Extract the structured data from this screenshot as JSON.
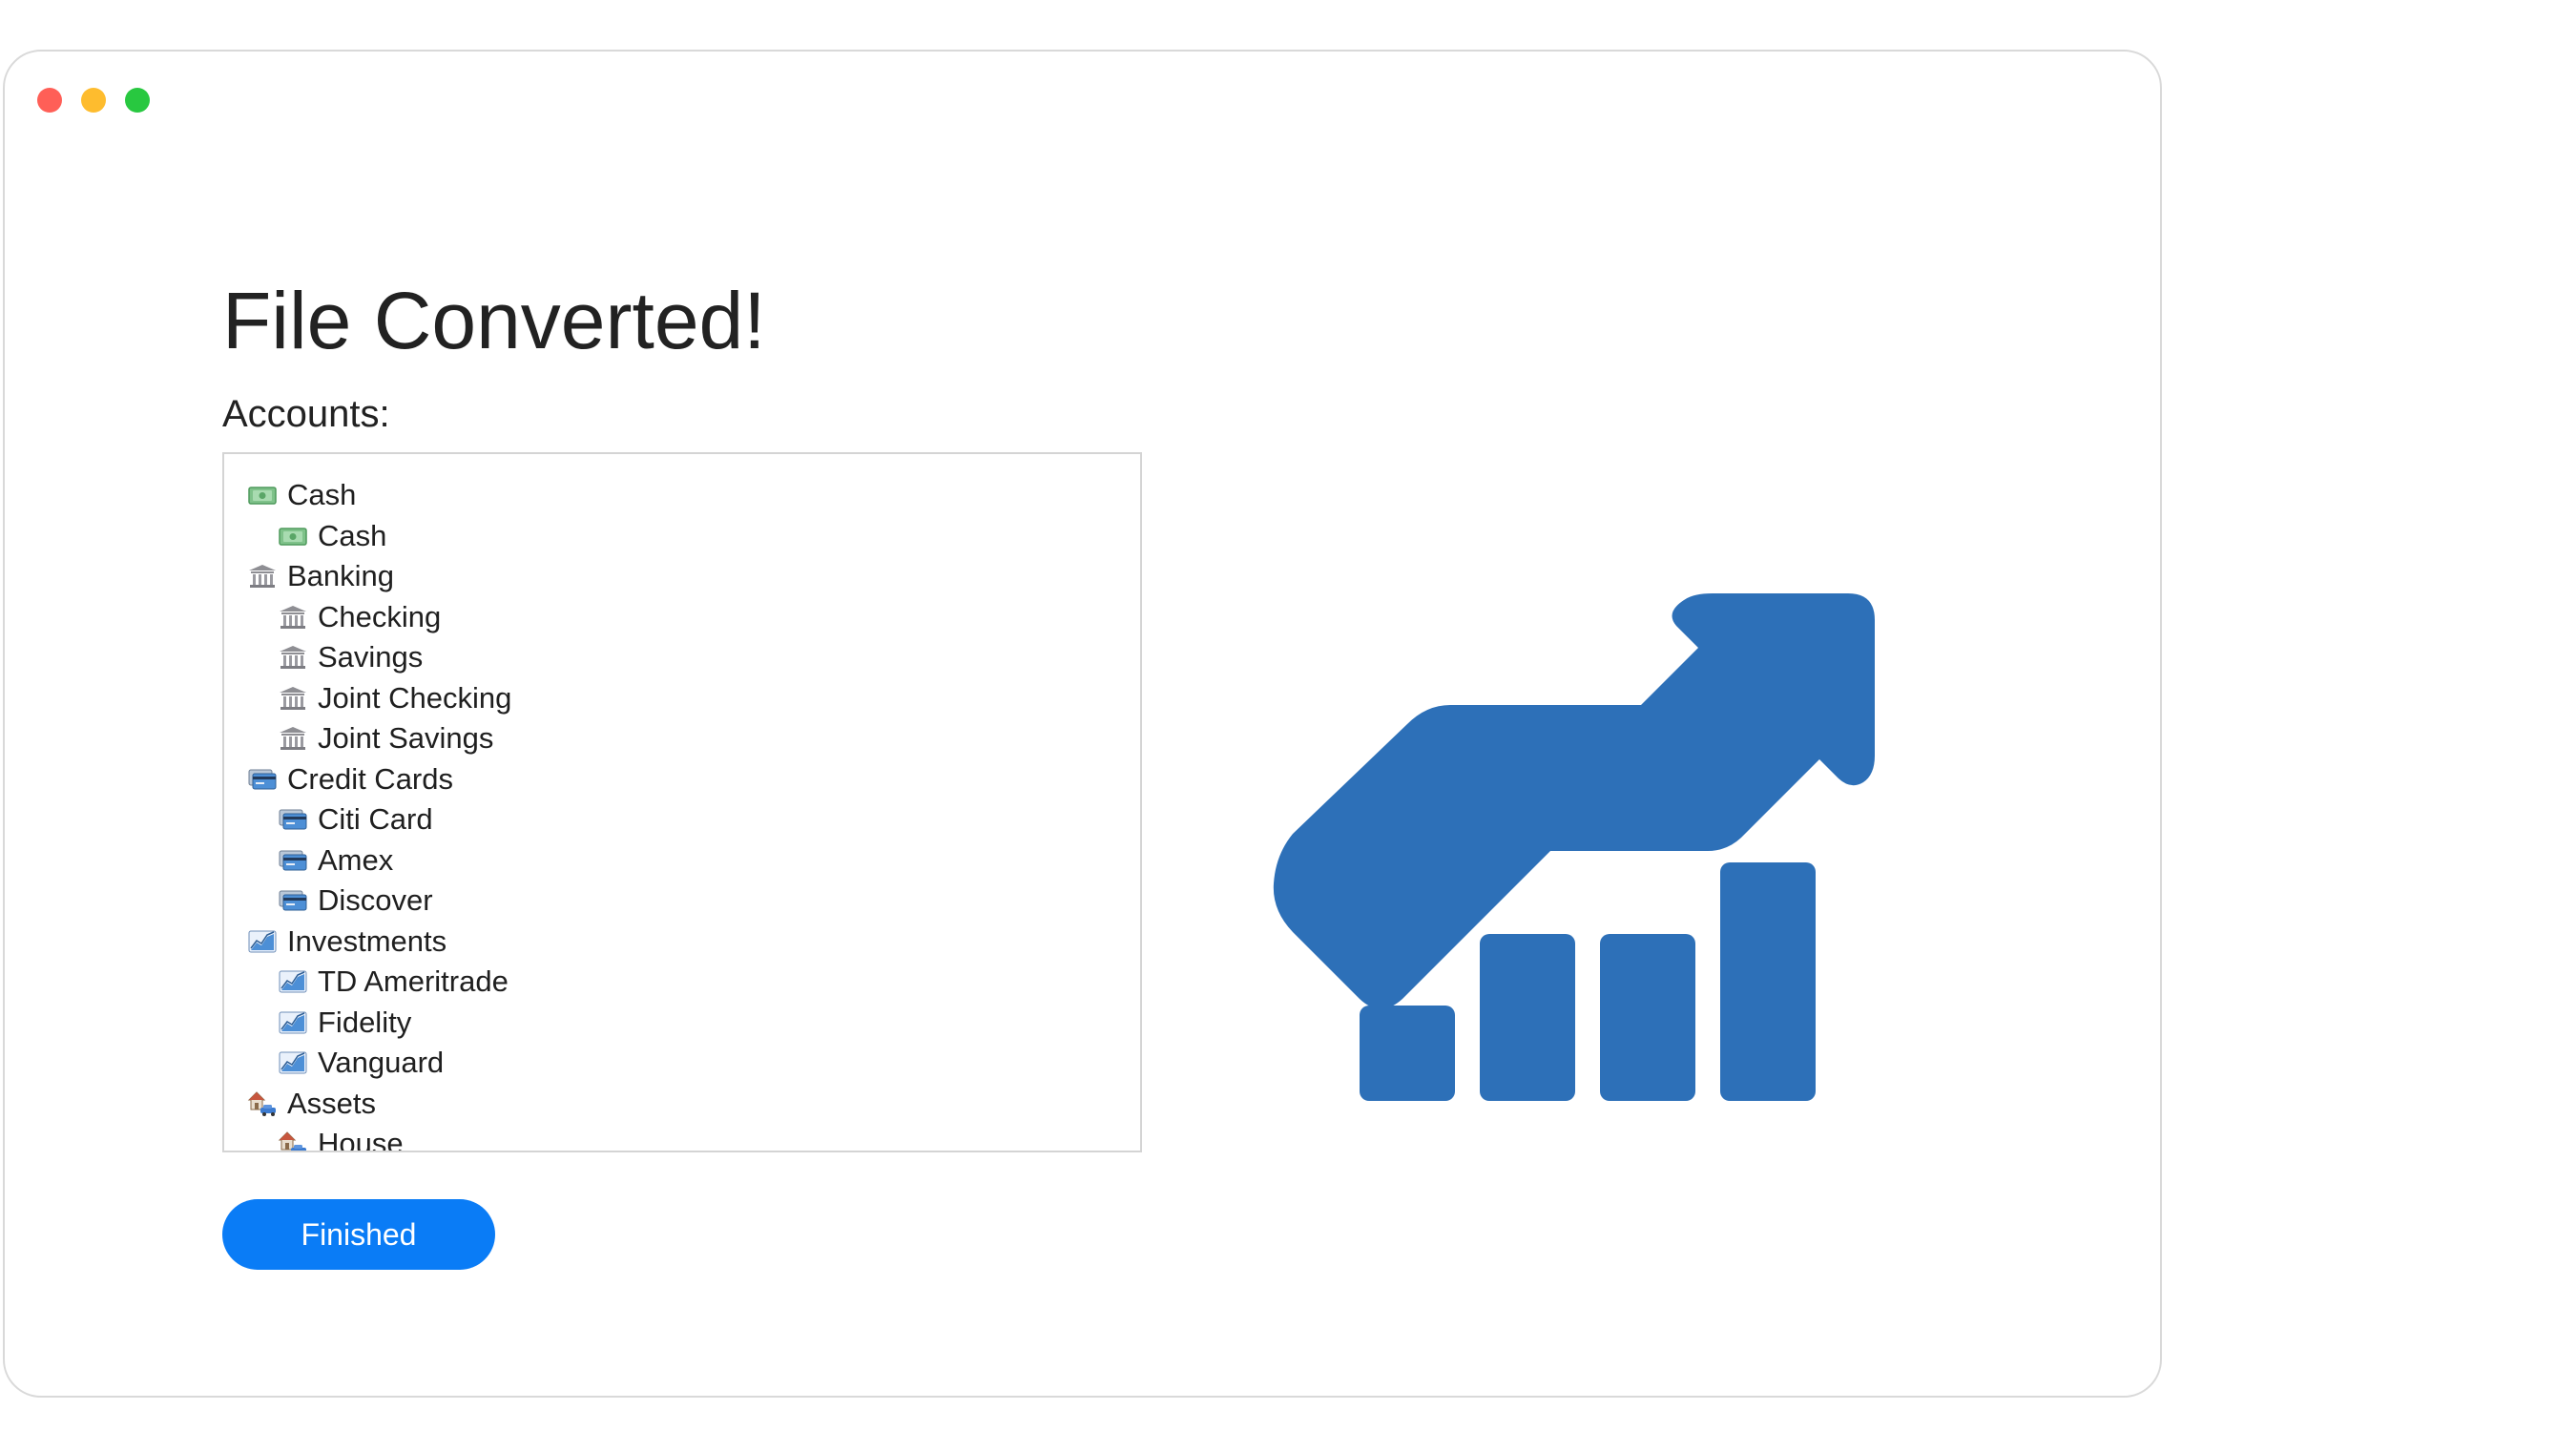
{
  "window": {
    "controls": [
      "close",
      "minimize",
      "zoom"
    ]
  },
  "heading": "File Converted!",
  "accounts_label": "Accounts:",
  "accounts": [
    {
      "label": "Cash",
      "icon": "cash-icon",
      "level": 0
    },
    {
      "label": "Cash",
      "icon": "cash-icon",
      "level": 1
    },
    {
      "label": "Banking",
      "icon": "bank-icon",
      "level": 0
    },
    {
      "label": "Checking",
      "icon": "bank-icon",
      "level": 1
    },
    {
      "label": "Savings",
      "icon": "bank-icon",
      "level": 1
    },
    {
      "label": "Joint Checking",
      "icon": "bank-icon",
      "level": 1
    },
    {
      "label": "Joint Savings",
      "icon": "bank-icon",
      "level": 1
    },
    {
      "label": "Credit Cards",
      "icon": "credit-card-icon",
      "level": 0
    },
    {
      "label": "Citi Card",
      "icon": "credit-card-icon",
      "level": 1
    },
    {
      "label": "Amex",
      "icon": "credit-card-icon",
      "level": 1
    },
    {
      "label": "Discover",
      "icon": "credit-card-icon",
      "level": 1
    },
    {
      "label": "Investments",
      "icon": "chart-icon",
      "level": 0
    },
    {
      "label": "TD Ameritrade",
      "icon": "chart-icon",
      "level": 1
    },
    {
      "label": "Fidelity",
      "icon": "chart-icon",
      "level": 1
    },
    {
      "label": "Vanguard",
      "icon": "chart-icon",
      "level": 1
    },
    {
      "label": "Assets",
      "icon": "house-car-icon",
      "level": 0
    },
    {
      "label": "House",
      "icon": "house-car-icon",
      "level": 1
    }
  ],
  "finish_button": "Finished",
  "hero_graphic": "growth-chart-arrow-icon",
  "colors": {
    "accent": "#0a7cf6",
    "hero": "#2d70b8",
    "close": "#ff5f57",
    "minimize": "#febc2e",
    "zoom": "#28c840"
  }
}
